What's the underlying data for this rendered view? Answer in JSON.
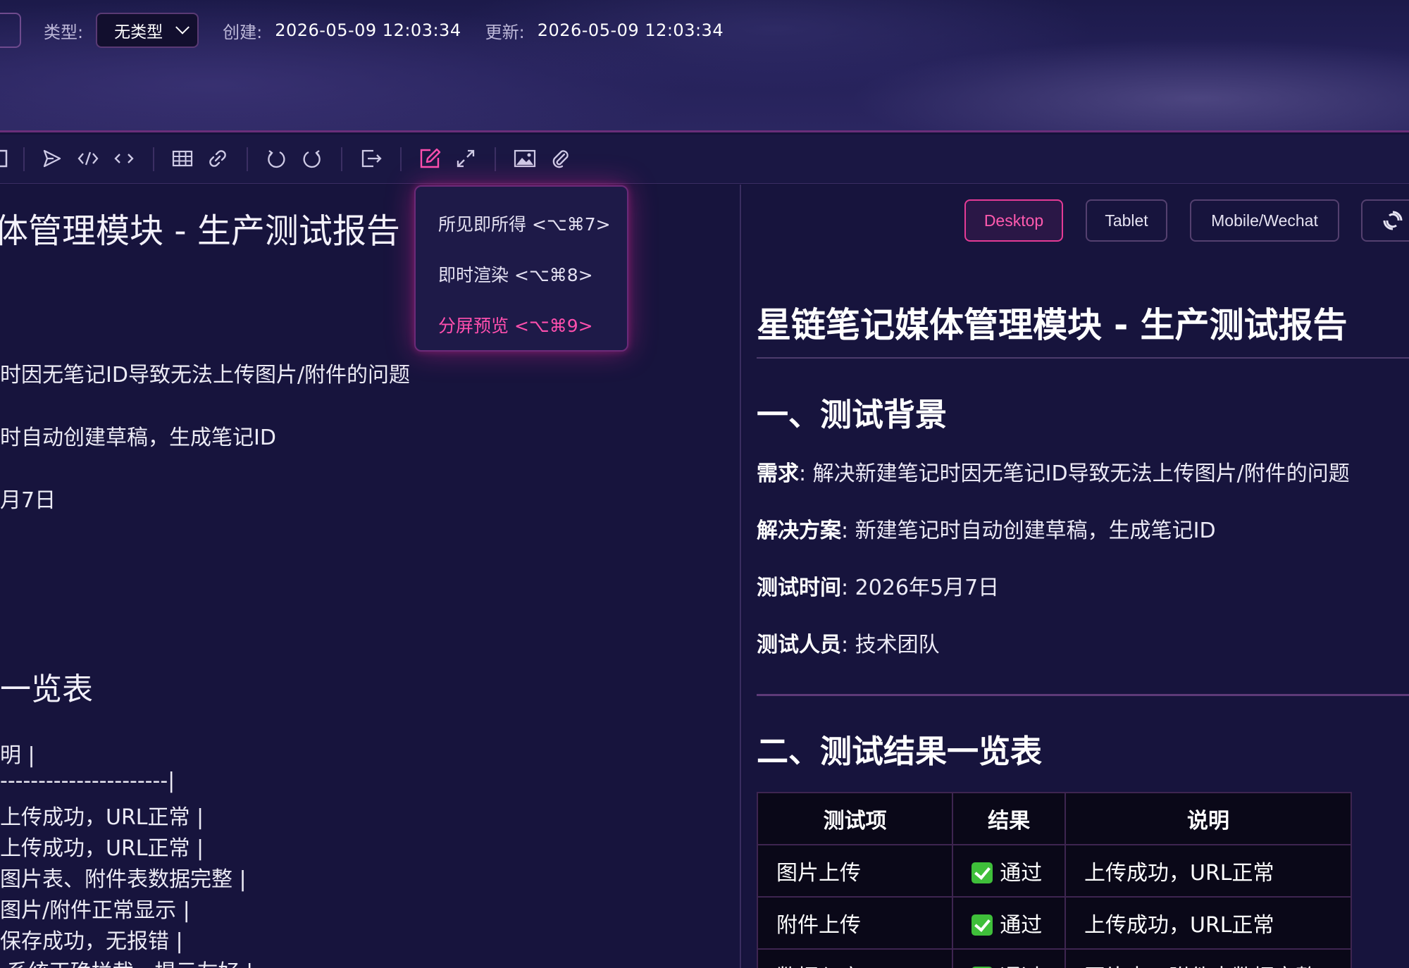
{
  "header": {
    "type_label": "类型:",
    "type_value": "无类型",
    "created_label": "创建:",
    "created_value": "2026-05-09 12:03:34",
    "updated_label": "更新:",
    "updated_value": "2026-05-09 12:03:34"
  },
  "toolbar": {
    "icons": [
      "send-icon",
      "code-block-icon",
      "inline-code-icon",
      "table-icon",
      "link-icon",
      "undo-icon",
      "redo-icon",
      "export-icon",
      "edit-mode-icon",
      "fullscreen-icon",
      "image-icon",
      "attachment-icon"
    ]
  },
  "mode_menu": {
    "items": [
      {
        "label": "所见即所得 <⌥⌘7>"
      },
      {
        "label": "即时渲染 <⌥⌘8>"
      },
      {
        "label": "分屏预览 <⌥⌘9>"
      }
    ],
    "active_index": 2
  },
  "editor": {
    "title_fragment": "体管理模块 - 生产测试报告",
    "lines": [
      "时因无笔记ID导致无法上传图片/附件的问题",
      "时自动创建草稿，生成笔记ID",
      "月7日",
      "一览表",
      "明                    |",
      "----------------------|",
      "上传成功，URL正常      |",
      "上传成功，URL正常      |",
      "图片表、附件表数据完整 |",
      "图片/附件正常显示      |",
      "保存成功，无报错       |",
      "| 系统正确拦截，提示友好 |"
    ]
  },
  "preview": {
    "device_buttons": [
      "Desktop",
      "Tablet",
      "Mobile/Wechat"
    ],
    "active_device": "Desktop",
    "title": "星链笔记媒体管理模块 - 生产测试报告",
    "section1": {
      "heading": "一、测试背景",
      "rows": [
        {
          "label": "需求",
          "sep": ":",
          "value": "解决新建笔记时因无笔记ID导致无法上传图片/附件的问题"
        },
        {
          "label": "解决方案",
          "sep": ":",
          "value": "新建笔记时自动创建草稿，生成笔记ID"
        },
        {
          "label": "测试时间",
          "sep": ":",
          "value": "2026年5月7日"
        },
        {
          "label": "测试人员",
          "sep": ":",
          "value": "技术团队"
        }
      ]
    },
    "section2": {
      "heading": "二、测试结果一览表",
      "table": {
        "headers": [
          "测试项",
          "结果",
          "说明"
        ],
        "rows": [
          [
            "图片上传",
            "通过",
            "上传成功，URL正常"
          ],
          [
            "附件上传",
            "通过",
            "上传成功，URL正常"
          ],
          [
            "数据入库",
            "通过",
            "图片表、附件表数据完整"
          ]
        ]
      }
    }
  },
  "colors": {
    "accent": "#ff4fae",
    "background": "#17143d",
    "pass": "#3fbf3a"
  }
}
